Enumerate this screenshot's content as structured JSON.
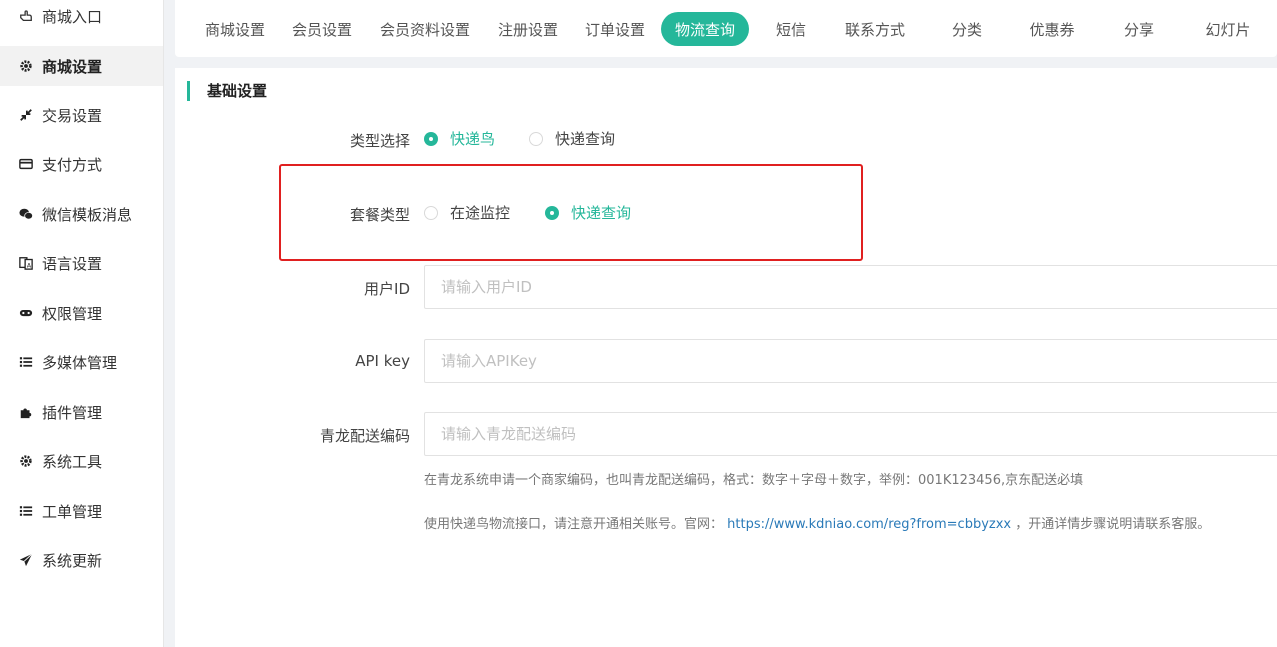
{
  "sidebar": {
    "items": [
      {
        "label": "商城入口",
        "icon": "hand-pointer-icon",
        "active": false
      },
      {
        "label": "商城设置",
        "icon": "gear-icon",
        "active": true
      },
      {
        "label": "交易设置",
        "icon": "compress-arrows-icon",
        "active": false
      },
      {
        "label": "支付方式",
        "icon": "credit-card-icon",
        "active": false
      },
      {
        "label": "微信模板消息",
        "icon": "wechat-icon",
        "active": false
      },
      {
        "label": "语言设置",
        "icon": "translate-icon",
        "active": false
      },
      {
        "label": "权限管理",
        "icon": "gamepad-icon",
        "active": false
      },
      {
        "label": "多媒体管理",
        "icon": "list-icon",
        "active": false
      },
      {
        "label": "插件管理",
        "icon": "puzzle-icon",
        "active": false
      },
      {
        "label": "系统工具",
        "icon": "gear-icon",
        "active": false
      },
      {
        "label": "工单管理",
        "icon": "list-icon",
        "active": false
      },
      {
        "label": "系统更新",
        "icon": "paper-plane-icon",
        "active": false
      }
    ]
  },
  "tabs": [
    {
      "label": "商城设置",
      "active": false
    },
    {
      "label": "会员设置",
      "active": false
    },
    {
      "label": "会员资料设置",
      "active": false
    },
    {
      "label": "注册设置",
      "active": false
    },
    {
      "label": "订单设置",
      "active": false
    },
    {
      "label": "物流查询",
      "active": true
    },
    {
      "label": "短信",
      "active": false
    },
    {
      "label": "联系方式",
      "active": false
    },
    {
      "label": "分类",
      "active": false
    },
    {
      "label": "优惠券",
      "active": false
    },
    {
      "label": "分享",
      "active": false
    },
    {
      "label": "幻灯片",
      "active": false
    }
  ],
  "section": {
    "title": "基础设置"
  },
  "form": {
    "type_select": {
      "label": "类型选择",
      "options": [
        "快递鸟",
        "快递查询"
      ],
      "selected": "快递鸟"
    },
    "package_type": {
      "label": "套餐类型",
      "options": [
        "在途监控",
        "快递查询"
      ],
      "selected": "快递查询"
    },
    "user_id": {
      "label": "用户ID",
      "value": "",
      "placeholder": "请输入用户ID"
    },
    "api_key": {
      "label": "API key",
      "value": "",
      "placeholder": "请输入APIKey"
    },
    "qinglong_code": {
      "label": "青龙配送编码",
      "value": "",
      "placeholder": "请输入青龙配送编码"
    },
    "help1": "在青龙系统申请一个商家编码，也叫青龙配送编码，格式：数字＋字母＋数字，举例：001K123456,京东配送必填",
    "help2_prefix": "使用快递鸟物流接口，请注意开通相关账号。官网：",
    "help2_link": "https://www.kdniao.com/reg?from=cbbyzxx",
    "help2_suffix": "，开通详情步骤说明请联系客服。"
  },
  "colors": {
    "accent": "#25b79a",
    "highlight": "#e02020",
    "link": "#2a7ab8"
  }
}
